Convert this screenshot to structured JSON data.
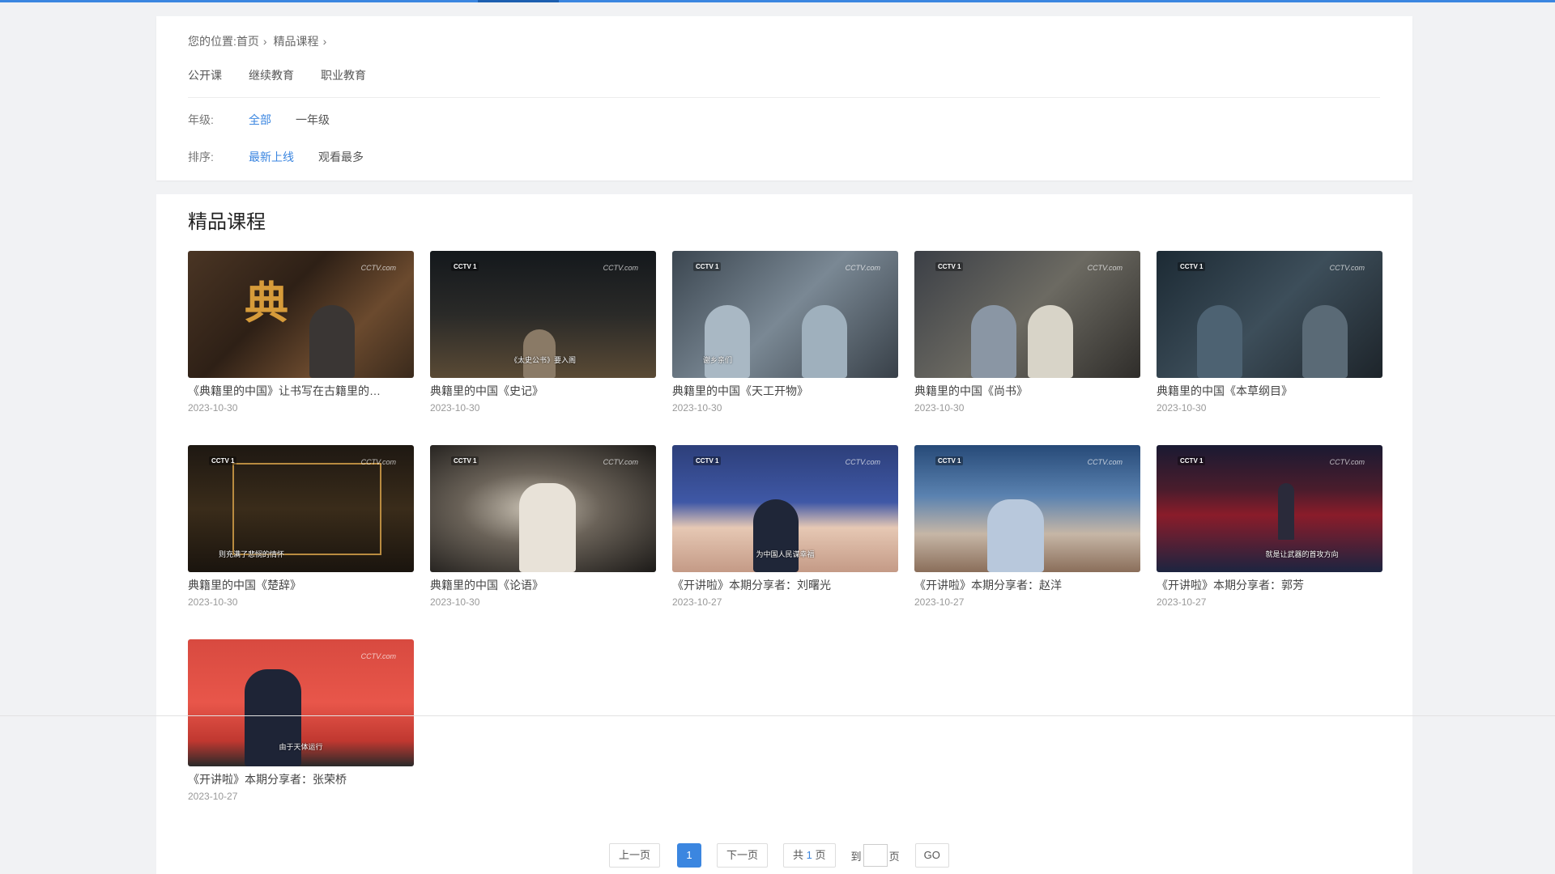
{
  "breadcrumb": {
    "prefix": "您的位置:",
    "home": "首页",
    "current": "精品课程"
  },
  "categories": [
    "公开课",
    "继续教育",
    "职业教育"
  ],
  "grade": {
    "label": "年级:",
    "options": [
      "全部",
      "一年级"
    ]
  },
  "sort": {
    "label": "排序:",
    "options": [
      "最新上线",
      "观看最多"
    ]
  },
  "section": {
    "title": "精品课程"
  },
  "courses": [
    {
      "title": "《典籍里的中国》让书写在古籍里的…",
      "date": "2023-10-30",
      "caption": ""
    },
    {
      "title": "典籍里的中国《史记》",
      "date": "2023-10-30",
      "caption": "《太史公书》要入阁"
    },
    {
      "title": "典籍里的中国《天工开物》",
      "date": "2023-10-30",
      "caption": "谢乡亲们"
    },
    {
      "title": "典籍里的中国《尚书》",
      "date": "2023-10-30",
      "caption": ""
    },
    {
      "title": "典籍里的中国《本草纲目》",
      "date": "2023-10-30",
      "caption": ""
    },
    {
      "title": "典籍里的中国《楚辞》",
      "date": "2023-10-30",
      "caption": "则充满了悲悯的情怀"
    },
    {
      "title": "典籍里的中国《论语》",
      "date": "2023-10-30",
      "caption": ""
    },
    {
      "title": "《开讲啦》本期分享者：刘曙光",
      "date": "2023-10-27",
      "caption": "为中国人民谋幸福"
    },
    {
      "title": "《开讲啦》本期分享者：赵洋",
      "date": "2023-10-27",
      "caption": ""
    },
    {
      "title": "《开讲啦》本期分享者：郭芳",
      "date": "2023-10-27",
      "caption": "就是让武器的首攻方向"
    },
    {
      "title": "《开讲啦》本期分享者：张荣桥",
      "date": "2023-10-27",
      "caption": "由于天体运行"
    }
  ],
  "pager": {
    "prev": "上一页",
    "current": "1",
    "next": "下一页",
    "total_prefix": "共",
    "total_num": "1",
    "total_suffix": "页",
    "goto_prefix": "到",
    "goto_suffix": "页",
    "go": "GO"
  },
  "colors": {
    "accent": "#3b86e0",
    "background": "#f1f2f4"
  }
}
